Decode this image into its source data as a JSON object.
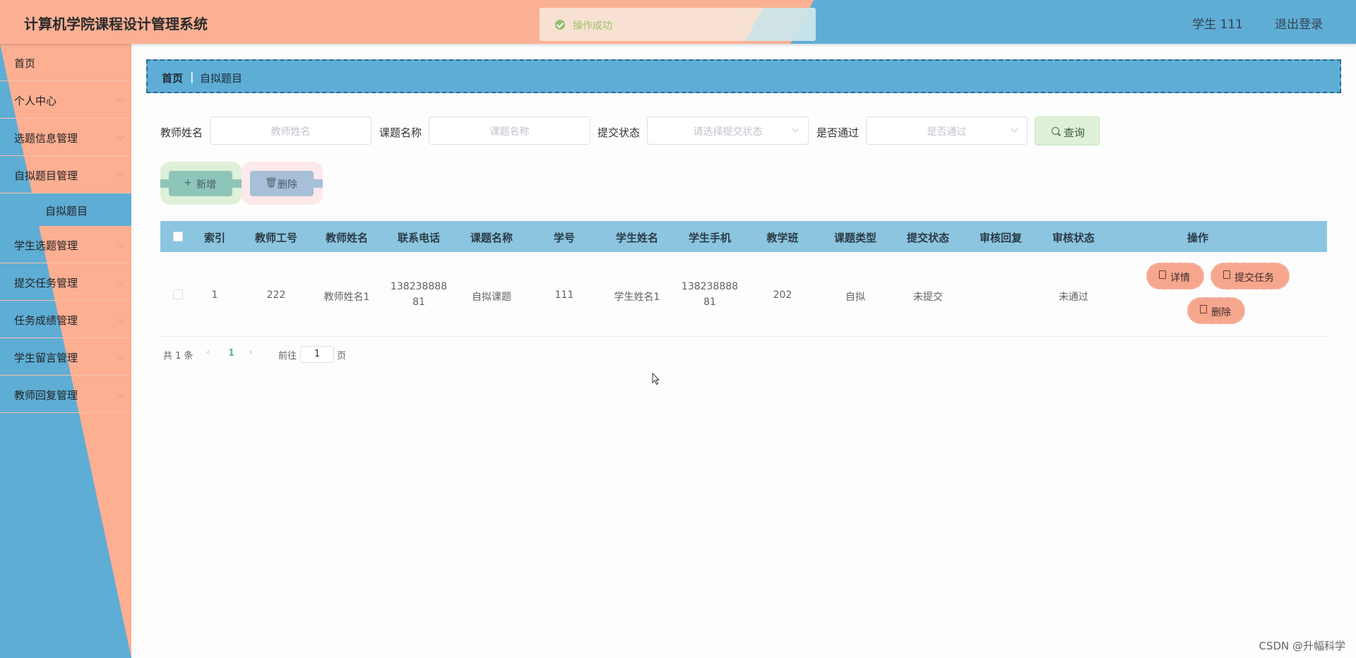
{
  "header": {
    "title": "计算机学院课程设计管理系统",
    "user": "学生 111",
    "logout": "退出登录"
  },
  "toast": {
    "message": "操作成功"
  },
  "sidebar": {
    "items": [
      {
        "label": "首页"
      },
      {
        "label": "个人中心"
      },
      {
        "label": "选题信息管理"
      },
      {
        "label": "自拟题目管理"
      },
      {
        "label": "学生选题管理"
      },
      {
        "label": "提交任务管理"
      },
      {
        "label": "任务成绩管理"
      },
      {
        "label": "学生留言管理"
      },
      {
        "label": "教师回复管理"
      }
    ],
    "active_sub": "自拟题目"
  },
  "breadcrumb": {
    "home": "首页",
    "separator": "|",
    "current": "自拟题目"
  },
  "search": {
    "teacher_label": "教师姓名",
    "teacher_placeholder": "教师姓名",
    "topic_label": "课题名称",
    "topic_placeholder": "课题名称",
    "status_label": "提交状态",
    "status_placeholder": "请选择提交状态",
    "pass_label": "是否通过",
    "pass_placeholder": "是否通过",
    "button": "查询"
  },
  "actions": {
    "add": "新增",
    "delete": "删除"
  },
  "table": {
    "columns": [
      "索引",
      "教师工号",
      "教师姓名",
      "联系电话",
      "课题名称",
      "学号",
      "学生姓名",
      "学生手机",
      "教学班",
      "课题类型",
      "提交状态",
      "审核回复",
      "审核状态",
      "操作"
    ],
    "rows": [
      {
        "index": "1",
        "teacher_id": "222",
        "teacher_name": "教师姓名1",
        "phone_line1": "138238888",
        "phone_line2": "81",
        "topic": "自拟课题",
        "student_id": "111",
        "student_name": "学生姓名1",
        "student_phone_line1": "138238888",
        "student_phone_line2": "81",
        "class": "202",
        "topic_type": "自拟",
        "submit_status": "未提交",
        "review_reply": "",
        "review_status": "未通过"
      }
    ],
    "ops": {
      "detail": "详情",
      "submit": "提交任务",
      "delete": "删除"
    }
  },
  "pagination": {
    "total": "共 1 条",
    "current": "1",
    "goto_label": "前往",
    "goto_value": "1",
    "page_suffix": "页"
  },
  "watermark": "CSDN @升幅科学",
  "colors": {
    "salmon": "#fbb094",
    "blue": "#5fadd5",
    "table_head": "#8cc5e0",
    "success": "#94c06f"
  }
}
